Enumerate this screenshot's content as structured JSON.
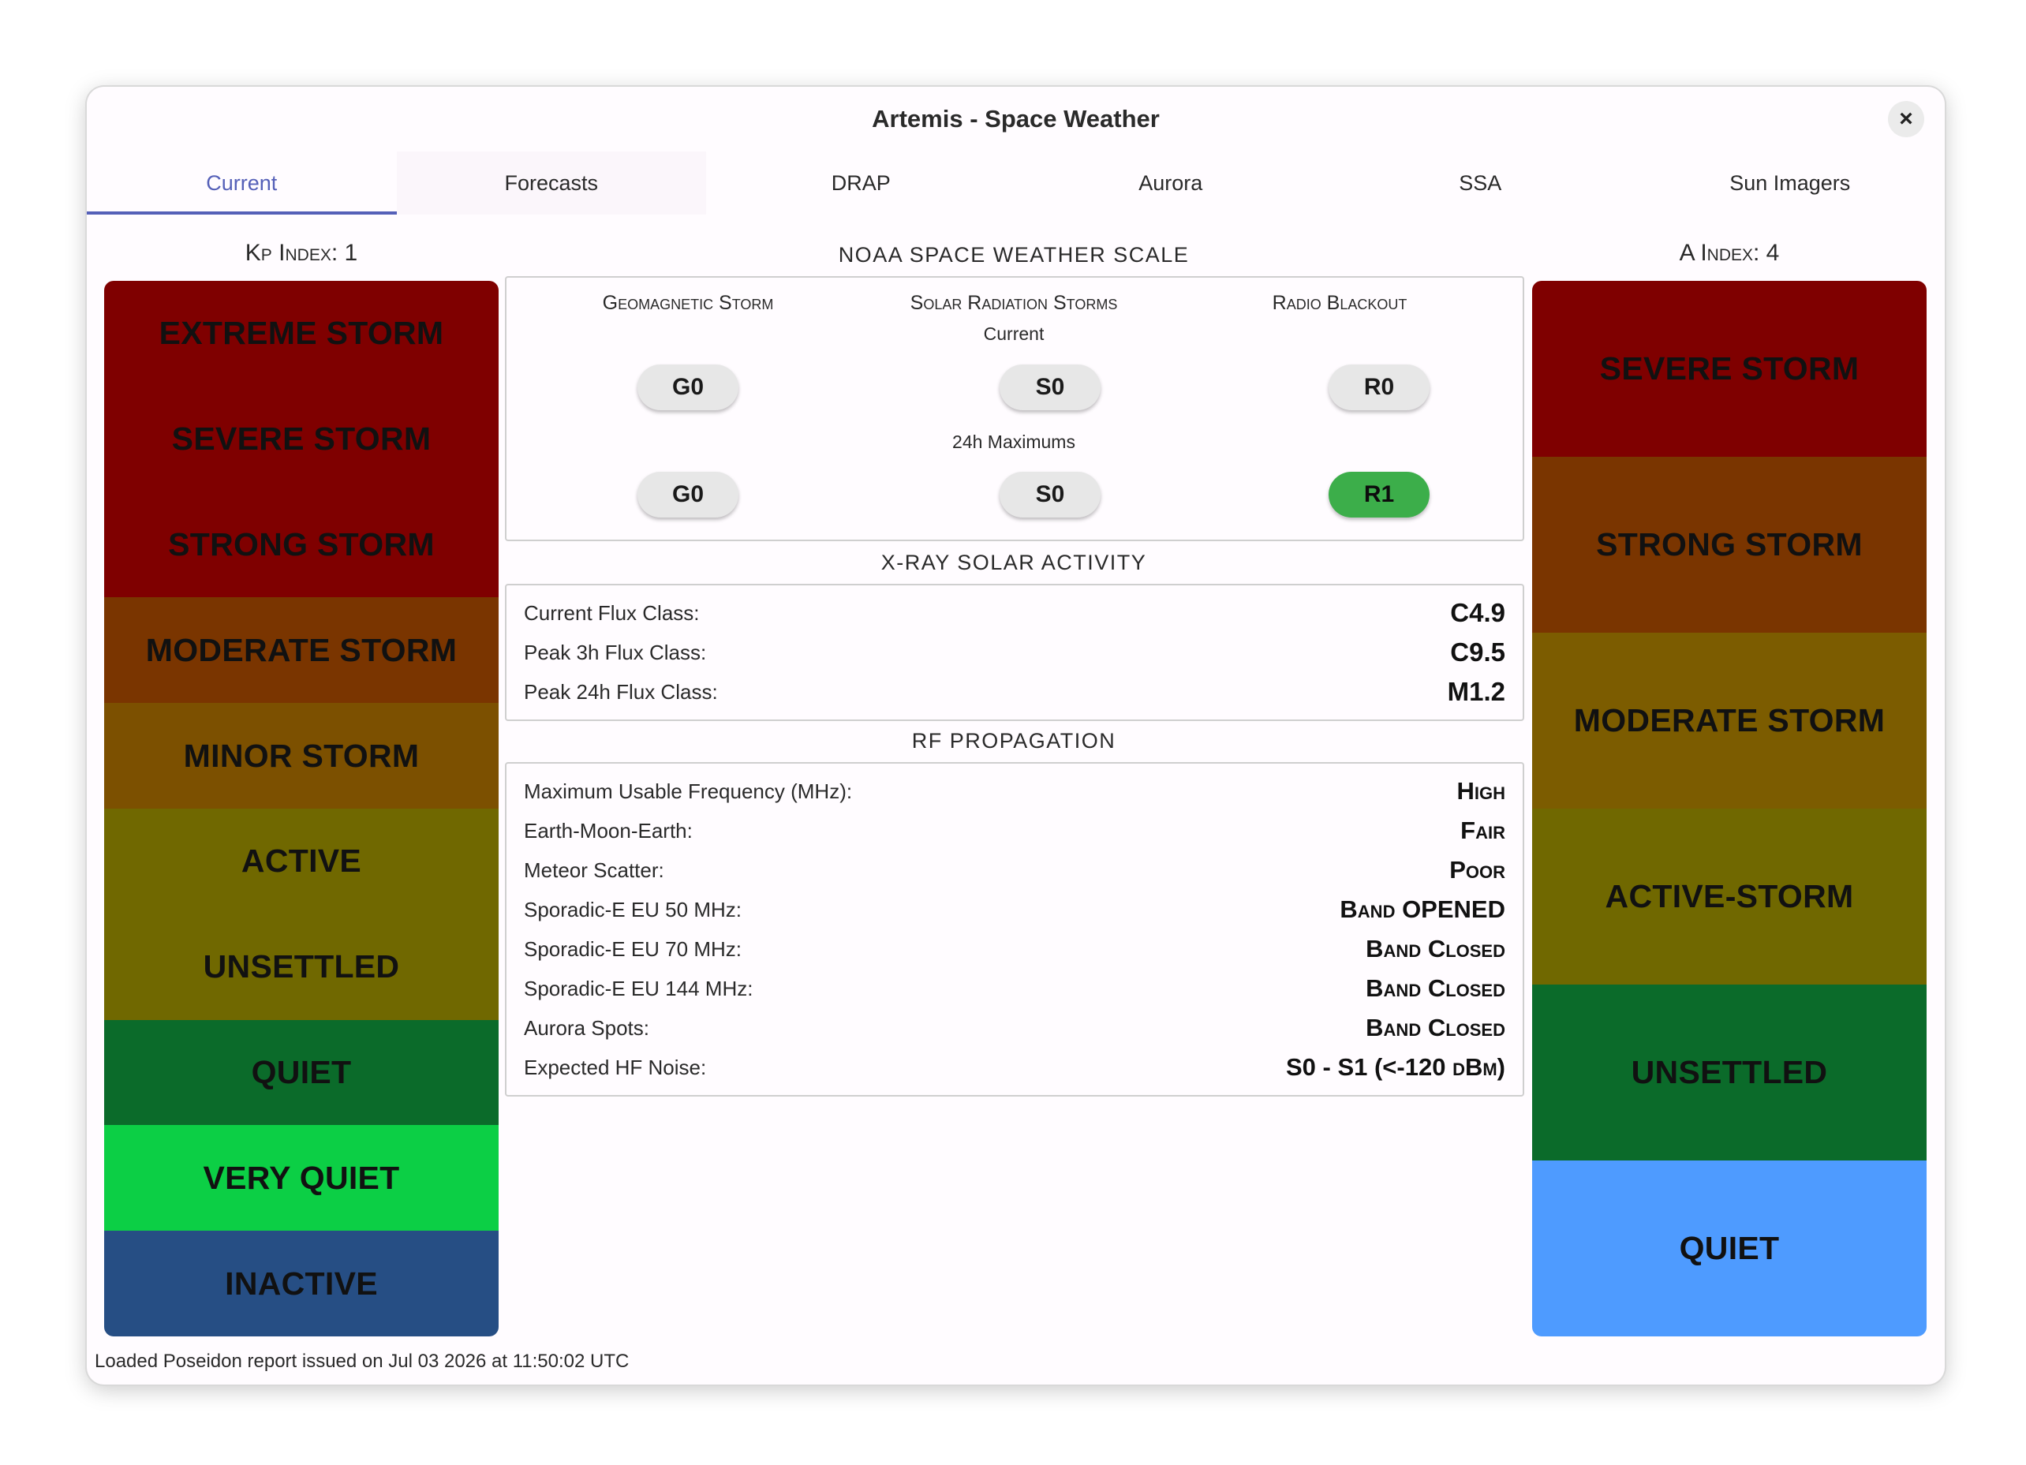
{
  "window": {
    "title": "Artemis - Space Weather",
    "close_label": "×"
  },
  "tabs": [
    {
      "label": "Current"
    },
    {
      "label": "Forecasts"
    },
    {
      "label": "DRAP"
    },
    {
      "label": "Aurora"
    },
    {
      "label": "SSA"
    },
    {
      "label": "Sun Imagers"
    }
  ],
  "kp": {
    "label": "Kp Index: 1",
    "bands": [
      {
        "label": "EXTREME STORM",
        "color": "#7f0000"
      },
      {
        "label": "SEVERE STORM",
        "color": "#7f0000"
      },
      {
        "label": "STRONG STORM",
        "color": "#7f0000"
      },
      {
        "label": "MODERATE STORM",
        "color": "#7a3500"
      },
      {
        "label": "MINOR STORM",
        "color": "#7c5000"
      },
      {
        "label": "ACTIVE",
        "color": "#706800"
      },
      {
        "label": "UNSETTLED",
        "color": "#706800"
      },
      {
        "label": "QUIET",
        "color": "#0b6b2a"
      },
      {
        "label": "VERY QUIET",
        "color": "#0ccf45"
      },
      {
        "label": "INACTIVE",
        "color": "#264e84"
      }
    ]
  },
  "a_index": {
    "label": "A Index: 4",
    "bands": [
      {
        "label": "SEVERE STORM",
        "color": "#7f0000"
      },
      {
        "label": "STRONG STORM",
        "color": "#7a3500"
      },
      {
        "label": "MODERATE STORM",
        "color": "#7c5c00"
      },
      {
        "label": "ACTIVE-STORM",
        "color": "#706800"
      },
      {
        "label": "UNSETTLED",
        "color": "#0b6b2a"
      },
      {
        "label": "QUIET",
        "color": "#4e9bff"
      }
    ]
  },
  "noaa": {
    "title": "NOAA SPACE WEATHER SCALE",
    "columns": [
      "Geomagnetic Storm",
      "Solar Radiation Storms",
      "Radio Blackout"
    ],
    "current_label": "Current",
    "max_label": "24h Maximums",
    "current": [
      "G0",
      "S0",
      "R0"
    ],
    "max": [
      "G0",
      "S0",
      "R1"
    ],
    "highlight_color": "#3cae4a"
  },
  "xray": {
    "title": "X-RAY SOLAR ACTIVITY",
    "rows": [
      {
        "label": "Current Flux Class:",
        "value": "C4.9"
      },
      {
        "label": "Peak 3h Flux Class:",
        "value": "C9.5"
      },
      {
        "label": "Peak 24h Flux Class:",
        "value": "M1.2"
      }
    ]
  },
  "rf": {
    "title": "RF PROPAGATION",
    "rows": [
      {
        "label": "Maximum Usable Frequency (MHz):",
        "value": "High"
      },
      {
        "label": "Earth-Moon-Earth:",
        "value": "Fair"
      },
      {
        "label": "Meteor Scatter:",
        "value": "Poor"
      },
      {
        "label": "Sporadic-E EU 50 MHz:",
        "value": "Band OPENED"
      },
      {
        "label": "Sporadic-E EU 70 MHz:",
        "value": "Band Closed"
      },
      {
        "label": "Sporadic-E EU 144 MHz:",
        "value": "Band Closed"
      },
      {
        "label": "Aurora Spots:",
        "value": "Band Closed"
      },
      {
        "label": "Expected HF Noise:",
        "value": "S0 - S1 (<-120 dBm)"
      }
    ]
  },
  "footer": {
    "status": "Loaded Poseidon report issued on Jul 03 2026 at 11:50:02 UTC"
  }
}
